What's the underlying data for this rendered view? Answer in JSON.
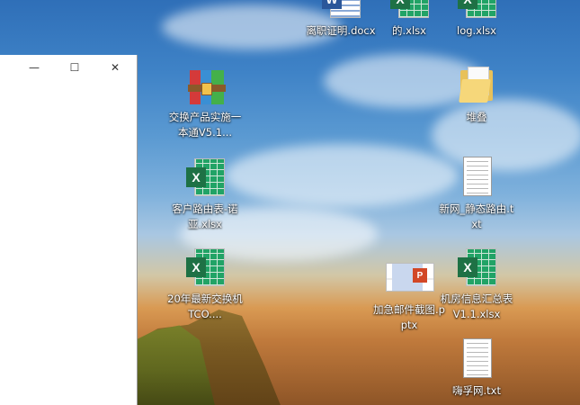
{
  "window": {
    "minimize_glyph": "—",
    "maximize_glyph": "☐",
    "close_glyph": "✕"
  },
  "icons": {
    "top_docx": {
      "label": "离职证明.docx",
      "type": "word-document-icon"
    },
    "top_xlsx": {
      "label": "的.xlsx",
      "type": "excel-spreadsheet-icon"
    },
    "top_log": {
      "label": "log.xlsx",
      "type": "excel-spreadsheet-icon"
    },
    "rar": {
      "label": "交换产品实施一本通V5.1...",
      "type": "winrar-archive-icon",
      "badge": ""
    },
    "folder_stack": {
      "label": "堆叠",
      "type": "folder-icon"
    },
    "xlsx_customer": {
      "label": "客户路由表-诺亚.xlsx",
      "type": "excel-spreadsheet-icon",
      "badge": "X"
    },
    "txt_static": {
      "label": "新网_静态路由.txt",
      "type": "text-file-icon"
    },
    "xlsx_tco": {
      "label": "20年最新交换机TCO....",
      "type": "excel-spreadsheet-icon",
      "badge": "X"
    },
    "pptx_mail": {
      "label": "加急邮件截图.pptx",
      "type": "powerpoint-presentation-icon",
      "badge": "P"
    },
    "xlsx_room": {
      "label": "机房信息汇总表V1.1.xlsx",
      "type": "excel-spreadsheet-icon",
      "badge": "X"
    },
    "txt_yijie": {
      "label": "嗨孚网.txt",
      "type": "text-file-icon"
    }
  },
  "badges": {
    "word": "W",
    "excel": "X"
  },
  "colors": {
    "excel": "#1e7145",
    "word": "#2b579a",
    "powerpoint": "#d24726",
    "folder": "#e8c15a"
  }
}
